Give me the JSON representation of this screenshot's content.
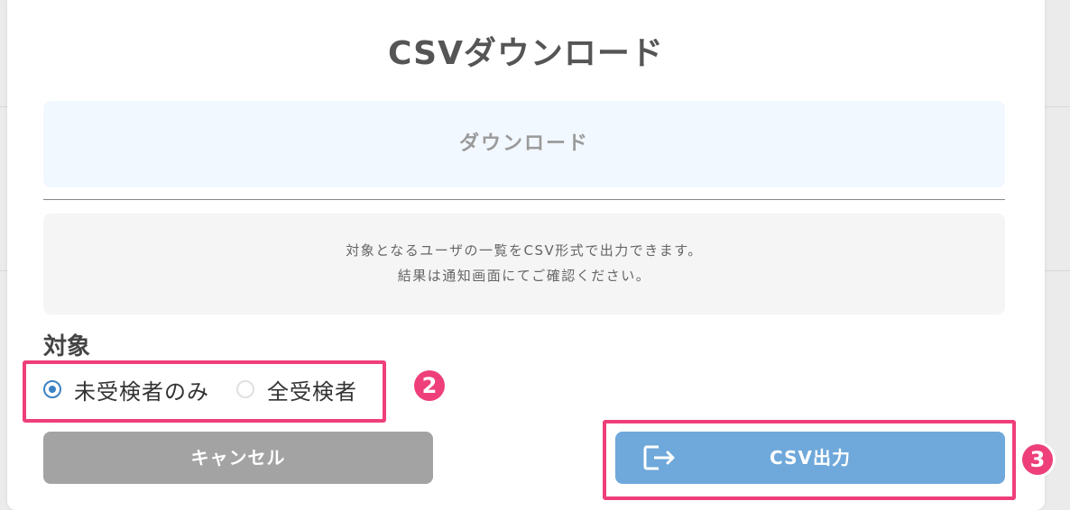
{
  "dialog": {
    "title": "CSVダウンロード",
    "tab_label": "ダウンロード",
    "description": [
      "対象となるユーザの一覧をCSV形式で出力できます。",
      "結果は通知画面にてご確認ください。"
    ]
  },
  "target": {
    "label": "対象",
    "options": [
      {
        "label": "未受検者のみ",
        "selected": true
      },
      {
        "label": "全受検者",
        "selected": false
      }
    ]
  },
  "buttons": {
    "cancel": "キャンセル",
    "export": "CSV出力",
    "export_icon": "export-icon"
  },
  "annotations": {
    "radio_marker": "2",
    "export_marker": "3",
    "color": "#ee3f7a"
  },
  "colors": {
    "accent": "#3b82c4",
    "export_button": "#6fa8da",
    "cancel_button": "#a3a3a3",
    "tab_background": "#f2f8ff"
  }
}
